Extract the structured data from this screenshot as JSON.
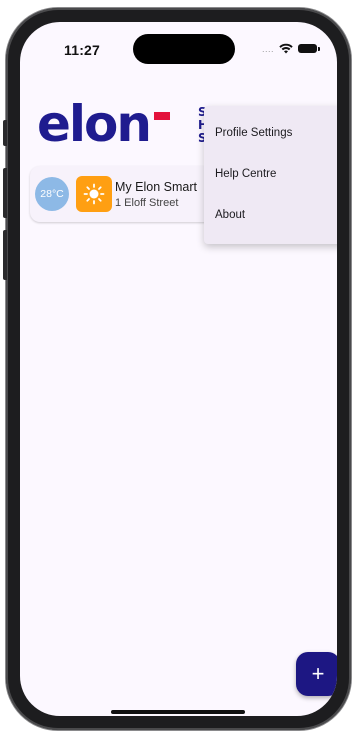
{
  "status_bar": {
    "time": "11:27",
    "icons": [
      "cellular-dots-icon",
      "wifi-icon",
      "battery-icon"
    ]
  },
  "header": {
    "logo_text": "elon",
    "logo_subtitle_lines": [
      "S",
      "H",
      "S"
    ],
    "colors": {
      "brand_blue": "#1f1c8f",
      "brand_red": "#e3123c"
    }
  },
  "home_card": {
    "temperature": "28°C",
    "weather_icon": "sun-icon",
    "name": "My Elon Smart",
    "address": "1 Eloff Street"
  },
  "menu": {
    "items": [
      {
        "label": "Profile Settings"
      },
      {
        "label": "Help Centre"
      },
      {
        "label": "About"
      }
    ]
  },
  "fab": {
    "label": "+",
    "icon": "plus-icon",
    "color": "#1d1783"
  },
  "colors": {
    "screen_bg": "#fcf8ff",
    "temp_badge": "#8db9e6",
    "weather_tile": "#ff9f12",
    "menu_bg": "#efe9f4"
  }
}
